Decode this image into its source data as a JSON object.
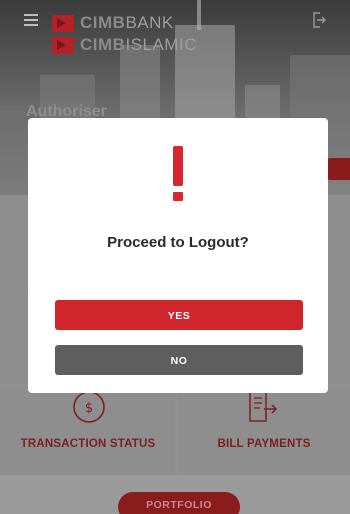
{
  "header": {
    "brand_line1_bold": "CIMB",
    "brand_line1_light": "BANK",
    "brand_line2_bold": "CIMB",
    "brand_line2_light": "ISLAMIC",
    "menu_icon": "hamburger-icon",
    "logout_icon": "logout-icon"
  },
  "page": {
    "heading": "Authoriser"
  },
  "tiles": [
    {
      "label": "TRANSACTION STATUS",
      "icon": "dollar-circle-icon"
    },
    {
      "label": "BILL PAYMENTS",
      "icon": "bill-payment-icon"
    }
  ],
  "portfolio_label": "PORTFOLIO",
  "dialog": {
    "icon": "exclamation-icon",
    "message": "Proceed to Logout?",
    "yes_label": "YES",
    "no_label": "NO"
  },
  "colors": {
    "brand_red": "#d0262b",
    "no_button": "#5e5e5e",
    "dialog_bg": "#ffffff"
  }
}
